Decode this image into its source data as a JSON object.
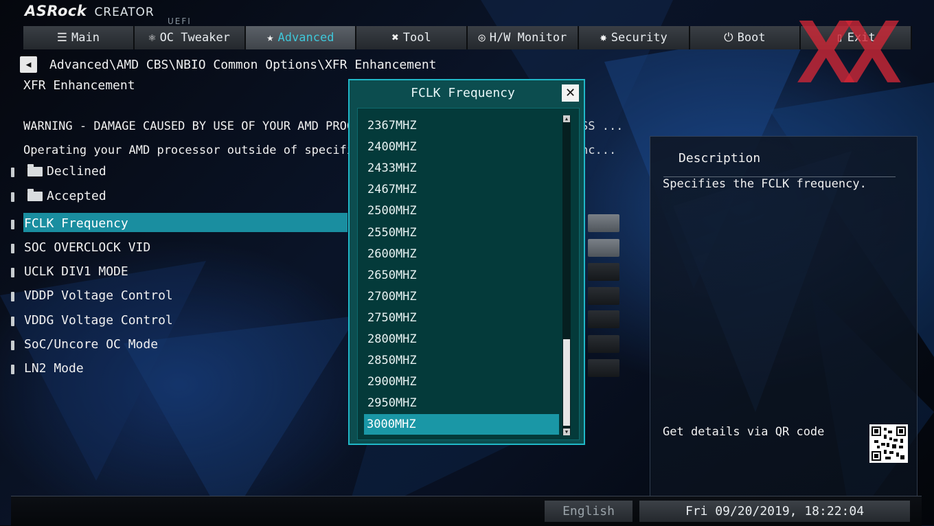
{
  "brand": {
    "logo": "ASRock",
    "product": "CREATOR",
    "firmware": "UEFI"
  },
  "tabs": [
    {
      "label": "Main",
      "icon": "list-icon",
      "glyph": "☰"
    },
    {
      "label": "OC Tweaker",
      "icon": "rocket-icon",
      "glyph": "⚛"
    },
    {
      "label": "Advanced",
      "icon": "star-icon",
      "glyph": "★"
    },
    {
      "label": "Tool",
      "icon": "tools-icon",
      "glyph": "✖"
    },
    {
      "label": "H/W Monitor",
      "icon": "monitor-icon",
      "glyph": "◎"
    },
    {
      "label": "Security",
      "icon": "shield-icon",
      "glyph": "✸"
    },
    {
      "label": "Boot",
      "icon": "power-icon",
      "glyph": "⏻"
    },
    {
      "label": "Exit",
      "icon": "exit-icon",
      "glyph": "▯"
    }
  ],
  "active_tab": "Advanced",
  "watermark": "XX",
  "breadcrumb": "Advanced\\AMD CBS\\NBIO Common Options\\XFR Enhancement",
  "page_title": "XFR Enhancement",
  "warnings": [
    {
      "text": "WARNING - DAMAGE CAUSED BY USE OF YOUR AMD PROCESSOR",
      "tail": "SS ..."
    },
    {
      "text": "Operating your AMD processor outside of specificatio",
      "tail": "nc..."
    }
  ],
  "menu": {
    "options": [
      "Declined",
      "Accepted"
    ],
    "settings": [
      "FCLK Frequency",
      "SOC OVERCLOCK VID",
      "UCLK DIV1 MODE",
      "VDDP Voltage Control",
      "VDDG Voltage Control",
      "SoC/Uncore OC Mode",
      "LN2 Mode"
    ],
    "highlighted": "FCLK Frequency"
  },
  "popup": {
    "title": "FCLK Frequency",
    "options": [
      "2367MHZ",
      "2400MHZ",
      "2433MHZ",
      "2467MHZ",
      "2500MHZ",
      "2550MHZ",
      "2600MHZ",
      "2650MHZ",
      "2700MHZ",
      "2750MHZ",
      "2800MHZ",
      "2850MHZ",
      "2900MHZ",
      "2950MHZ",
      "3000MHZ"
    ],
    "selected": "3000MHZ"
  },
  "description": {
    "title": "Description",
    "text": "Specifies the FCLK frequency.",
    "qr_label": "Get details via QR code"
  },
  "footer": {
    "language": "English",
    "datetime": "Fri 09/20/2019, 18:22:04"
  },
  "colors": {
    "accent": "#1a8ea0",
    "active_tab_text": "#3fc7d9",
    "popup_bg": "#0c4d4f",
    "popup_border": "#20b8c8",
    "watermark": "#d22837"
  }
}
